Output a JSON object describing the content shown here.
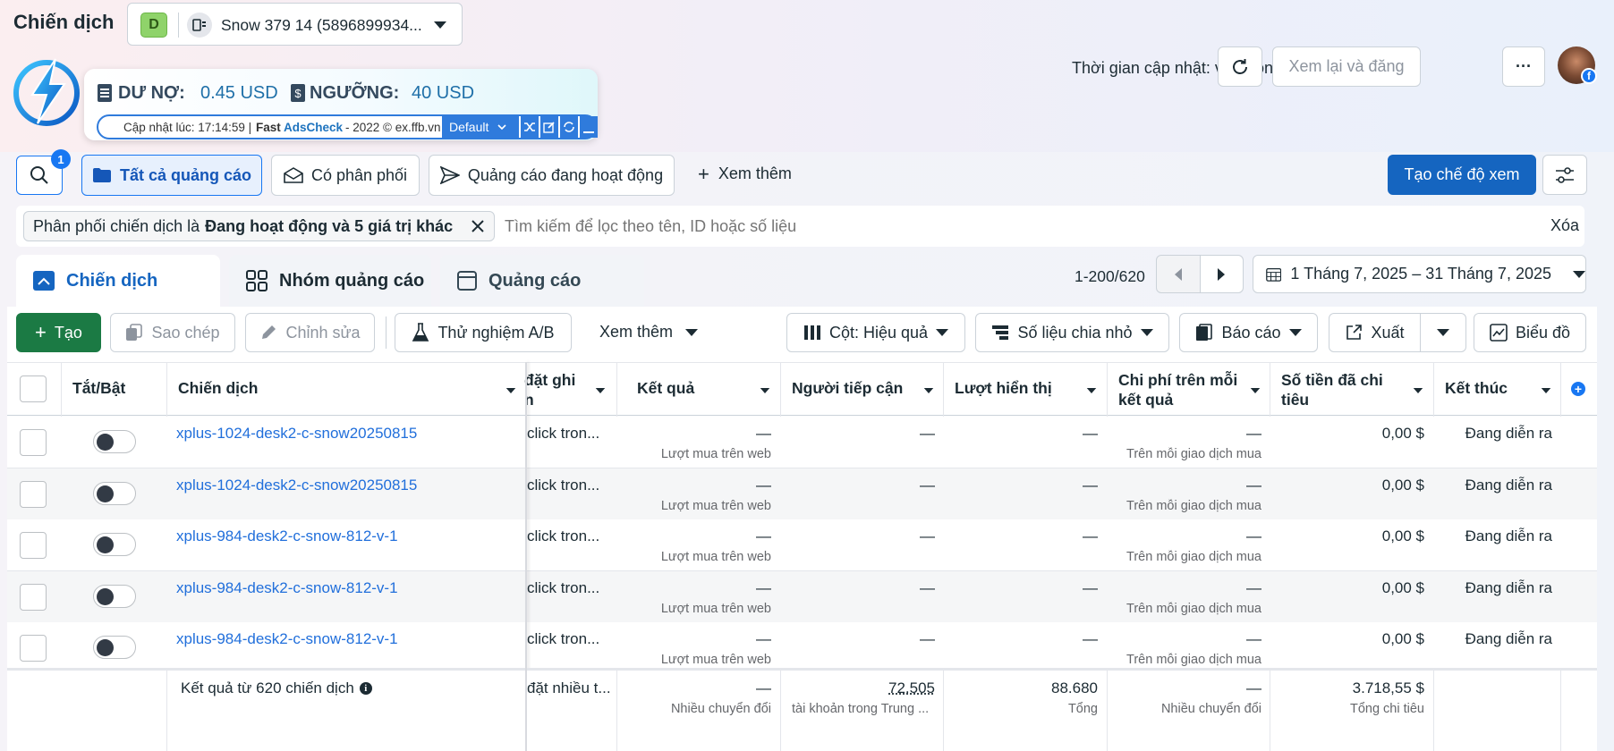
{
  "header": {
    "title": "Chiến dịch",
    "account_letter": "D",
    "account_name": "Snow 379 14 (5896899934...",
    "update_time": "Thời gian cập nhật: vừa xong",
    "review_button": "Xem lại và đăng",
    "more": "···"
  },
  "extension": {
    "debt_label": "DƯ NỢ:",
    "debt_value": "0.45 USD",
    "threshold_label": "NGƯỠNG:",
    "threshold_value": "40 USD",
    "updated_prefix": "Cập nhật lúc: 17:14:59 |",
    "brand_fast": "Fast",
    "brand_ads": "AdsCheck",
    "brand_suffix": "- 2022 © ex.ffb.vn",
    "profile_select": "Default"
  },
  "filters": {
    "search_badge": "1",
    "tabs": [
      "Tất cả quảng cáo",
      "Có phân phối",
      "Quảng cáo đang hoạt động"
    ],
    "see_more": "Xem thêm",
    "create_view": "Tạo chế độ xem",
    "chip_prefix": "Phân phối chiến dịch là",
    "chip_bold": "Đang hoạt động và 5 giá trị khác",
    "search_placeholder": "Tìm kiếm để lọc theo tên, ID hoặc số liệu",
    "clear": "Xóa"
  },
  "level_tabs": [
    "Chiến dịch",
    "Nhóm quảng cáo",
    "Quảng cáo"
  ],
  "pagination": {
    "range": "1-200/620",
    "date_range": "1 Tháng 7, 2025 – 31 Tháng 7, 2025"
  },
  "actions": {
    "create": "Tạo",
    "duplicate": "Sao chép",
    "edit": "Chỉnh sửa",
    "ab_test": "Thử nghiệm A/B",
    "more": "Xem thêm",
    "columns": "Cột: Hiệu quả",
    "breakdown": "Số liệu chia nhỏ",
    "reports": "Báo cáo",
    "export": "Xuất",
    "chart": "Biểu đồ"
  },
  "table": {
    "headers": {
      "toggle": "Tắt/Bật",
      "campaign": "Chiến dịch",
      "bid_line1": "đặt ghi",
      "bid_line2": "n",
      "results": "Kết quả",
      "reach": "Người tiếp cận",
      "impressions": "Lượt hiển thị",
      "cpr_line1": "Chi phí trên mỗi",
      "cpr_line2": "kết quả",
      "spent_line1": "Số tiền đã chi",
      "spent_line2": "tiêu",
      "end": "Kết thúc"
    },
    "rows": [
      {
        "name": "xplus-1024-desk2-c-snow20250815",
        "bid": "click tron...",
        "result": "—",
        "result_sub": "Lượt mua trên web",
        "reach": "—",
        "impr": "—",
        "cpr": "—",
        "cpr_sub": "Trên mỗi giao dịch mua",
        "spent": "0,00 $",
        "end": "Đang diễn ra"
      },
      {
        "name": "xplus-1024-desk2-c-snow20250815",
        "bid": "click tron...",
        "result": "—",
        "result_sub": "Lượt mua trên web",
        "reach": "—",
        "impr": "—",
        "cpr": "—",
        "cpr_sub": "Trên mỗi giao dịch mua",
        "spent": "0,00 $",
        "end": "Đang diễn ra"
      },
      {
        "name": "xplus-984-desk2-c-snow-812-v-1",
        "bid": "click tron...",
        "result": "—",
        "result_sub": "Lượt mua trên web",
        "reach": "—",
        "impr": "—",
        "cpr": "—",
        "cpr_sub": "Trên mỗi giao dịch mua",
        "spent": "0,00 $",
        "end": "Đang diễn ra"
      },
      {
        "name": "xplus-984-desk2-c-snow-812-v-1",
        "bid": "click tron...",
        "result": "—",
        "result_sub": "Lượt mua trên web",
        "reach": "—",
        "impr": "—",
        "cpr": "—",
        "cpr_sub": "Trên mỗi giao dịch mua",
        "spent": "0,00 $",
        "end": "Đang diễn ra"
      },
      {
        "name": "xplus-984-desk2-c-snow-812-v-1",
        "bid": "click tron...",
        "result": "—",
        "result_sub": "Lượt mua trên web",
        "reach": "—",
        "impr": "—",
        "cpr": "—",
        "cpr_sub": "Trên mỗi giao dịch mua",
        "spent": "0,00 $",
        "end": "Đang diễn ra"
      }
    ],
    "summary": {
      "label": "Kết quả từ 620 chiến dịch",
      "bid": "đặt nhiều t...",
      "result": "—",
      "result_sub": "Nhiều chuyển đổi",
      "reach": "72.505",
      "reach_sub": "tài khoản trong Trung ...",
      "impr": "88.680",
      "impr_sub": "Tổng",
      "cpr": "—",
      "cpr_sub": "Nhiều chuyển đổi",
      "spent": "3.718,55 $",
      "spent_sub": "Tổng chi tiêu"
    }
  }
}
